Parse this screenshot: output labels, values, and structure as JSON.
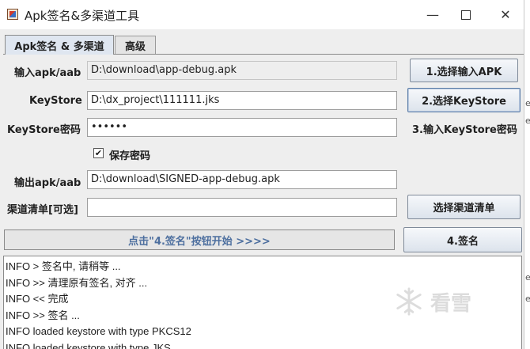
{
  "window": {
    "title": "Apk签名&多渠道工具",
    "controls": {
      "minimize": "—",
      "maximize": "",
      "close": "✕"
    }
  },
  "tabs": [
    {
      "label": "Apk签名 & 多渠道",
      "active": true
    },
    {
      "label": "高级",
      "active": false
    }
  ],
  "form": {
    "input_apk": {
      "label": "输入apk/aab",
      "value": "D:\\download\\app-debug.apk",
      "button": "1.选择输入APK"
    },
    "keystore": {
      "label": "KeyStore",
      "value": "D:\\dx_project\\111111.jks",
      "button": "2.选择KeyStore"
    },
    "keystore_password": {
      "label": "KeyStore密码",
      "value": "••••••",
      "hint": "3.输入KeyStore密码"
    },
    "save_password": {
      "label": "保存密码",
      "checked": true,
      "mark": "✔"
    },
    "output_apk": {
      "label": "输出apk/aab",
      "value": "D:\\download\\SIGNED-app-debug.apk"
    },
    "channel_list": {
      "label": "渠道清单[可选]",
      "value": "",
      "button": "选择渠道清单"
    }
  },
  "action": {
    "progress_text": "点击\"4.签名\"按钮开始  >>>>",
    "sign_button": "4.签名"
  },
  "log": [
    "INFO > 签名中, 请稍等 ...",
    "INFO >> 清理原有签名, 对齐 ...",
    "INFO << 完成",
    "INFO >> 签名 ...",
    "INFO loaded keystore with type PKCS12",
    "INFO loaded keystore with type JKS"
  ],
  "watermark": {
    "text": "看雪"
  },
  "edge_glyphs": [
    "e",
    "e",
    "e",
    "e"
  ],
  "colors": {
    "accent_text": "#4d6f9f",
    "tab_active": "#dfe6f0"
  }
}
